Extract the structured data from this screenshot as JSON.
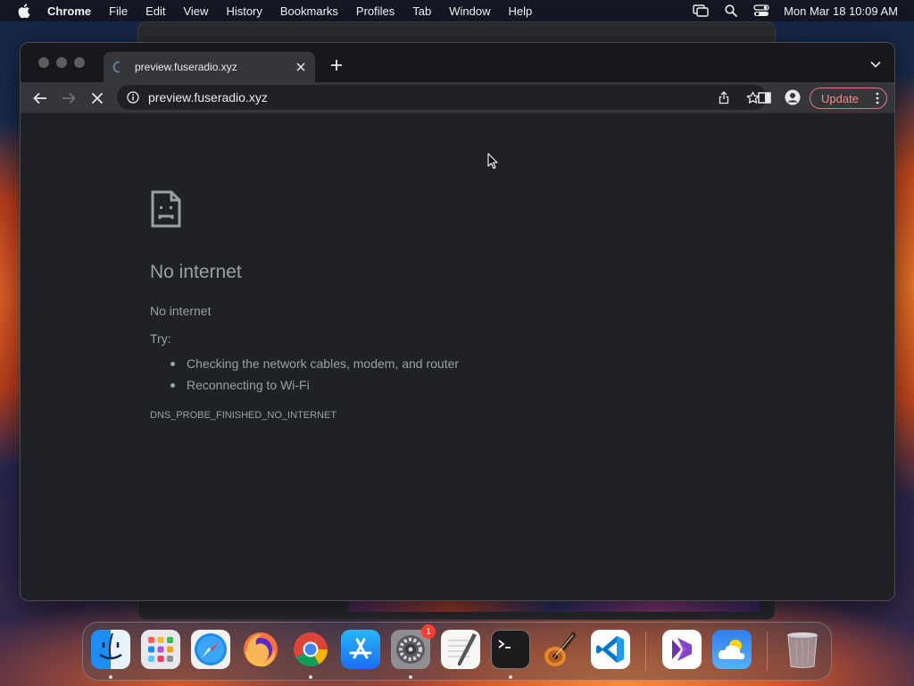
{
  "menubar": {
    "app_name": "Chrome",
    "items": [
      "File",
      "Edit",
      "View",
      "History",
      "Bookmarks",
      "Profiles",
      "Tab",
      "Window",
      "Help"
    ],
    "clock": "Mon Mar 18  10:09 AM"
  },
  "tab": {
    "title": "preview.fuseradio.xyz"
  },
  "toolbar": {
    "url": "preview.fuseradio.xyz",
    "update_label": "Update"
  },
  "error_page": {
    "title": "No internet",
    "subtitle": "No internet",
    "try_label": "Try:",
    "suggestions": [
      "Checking the network cables, modem, and router",
      "Reconnecting to Wi-Fi"
    ],
    "error_code": "DNS_PROBE_FINISHED_NO_INTERNET"
  },
  "dock": {
    "apps": [
      {
        "name": "finder",
        "running": true
      },
      {
        "name": "launchpad",
        "running": false
      },
      {
        "name": "safari",
        "running": false
      },
      {
        "name": "firefox",
        "running": false
      },
      {
        "name": "chrome",
        "running": true
      },
      {
        "name": "app-store",
        "running": false
      },
      {
        "name": "system-settings",
        "running": true,
        "badge": "1"
      },
      {
        "name": "textedit",
        "running": false
      },
      {
        "name": "terminal",
        "running": true
      },
      {
        "name": "garageband",
        "running": false
      },
      {
        "name": "vscode",
        "running": false
      },
      {
        "name": "visual-studio",
        "running": false
      },
      {
        "name": "weather",
        "running": false
      },
      {
        "name": "trash",
        "running": false
      }
    ]
  },
  "colors": {
    "update_accent": "#f28b82",
    "error_text": "#9aa0a6",
    "page_background": "#202124"
  }
}
